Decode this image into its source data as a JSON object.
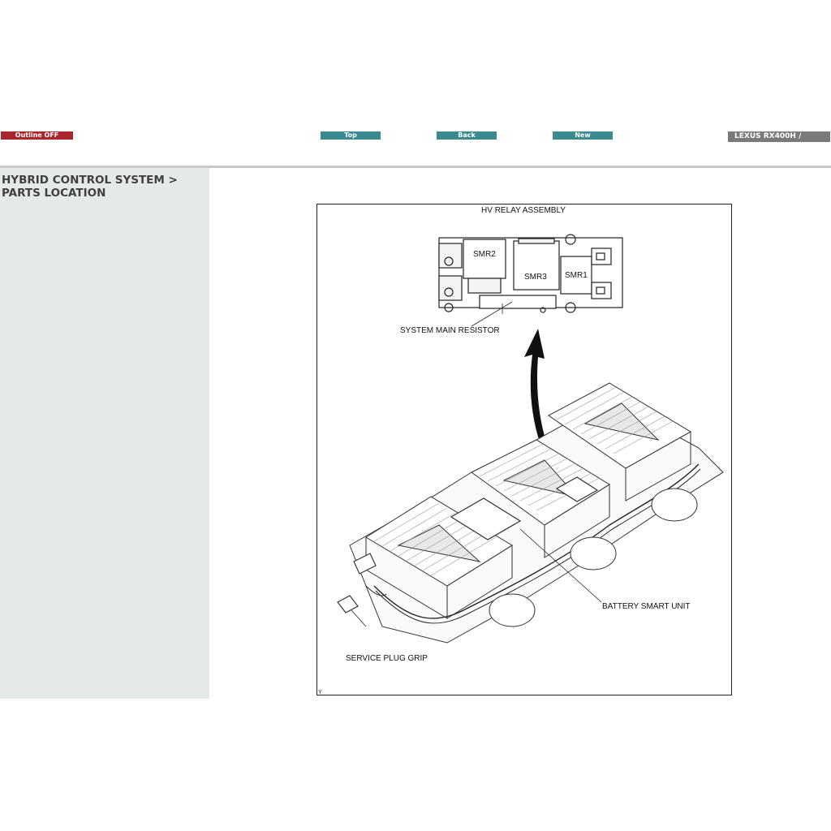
{
  "toolbar": {
    "outline_label": "Outline OFF",
    "top_label": "Top",
    "back_label": "Back",
    "new_label": "New",
    "model_label": "LEXUS RX400H /"
  },
  "breadcrumb": {
    "line1": "HYBRID CONTROL SYSTEM >",
    "line2": "PARTS LOCATION"
  },
  "figure": {
    "title": "HV RELAY ASSEMBLY",
    "smr1": "SMR1",
    "smr2": "SMR2",
    "smr3": "SMR3",
    "resistor_label": "SYSTEM MAIN RESISTOR",
    "battery_unit_label": "BATTERY SMART UNIT",
    "service_plug_label": "SERVICE PLUG GRIP",
    "corner_mark": "Y"
  },
  "colors": {
    "outline_button": "#a8262c",
    "nav_button": "#3a8a8f",
    "model_badge": "#7a7a7a",
    "sidebar_bg": "#e4ebe7"
  }
}
